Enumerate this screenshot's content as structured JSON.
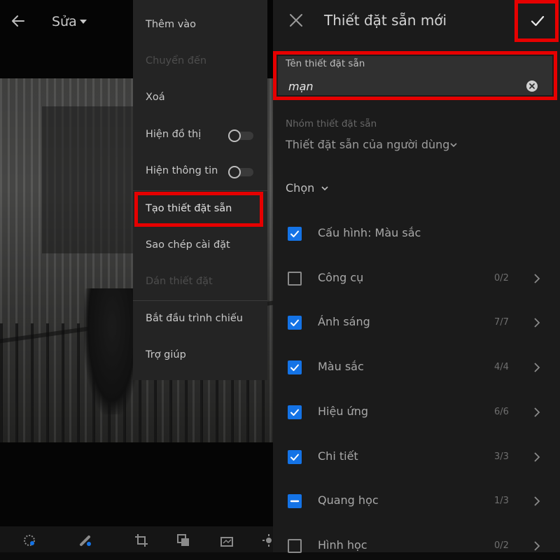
{
  "left": {
    "title": "Sửa"
  },
  "menu": {
    "items": [
      {
        "label": "Thêm vào",
        "disabled": false
      },
      {
        "label": "Chuyển đến",
        "disabled": true
      },
      {
        "label": "Xoá",
        "disabled": false
      },
      {
        "label": "Hiện đồ thị",
        "disabled": false,
        "toggle": false
      },
      {
        "label": "Hiện thông tin",
        "disabled": false,
        "toggle": false
      },
      {
        "label": "Tạo thiết đặt sẵn",
        "disabled": false,
        "highlighted": true
      },
      {
        "label": "Sao chép cài đặt",
        "disabled": false
      },
      {
        "label": "Dán thiết đặt",
        "disabled": true
      },
      {
        "label": "Bắt đầu trình chiếu",
        "disabled": false
      },
      {
        "label": "Trợ giúp",
        "disabled": false
      }
    ]
  },
  "panel": {
    "title": "Thiết đặt sẵn mới",
    "name_field": {
      "label": "Tên thiết đặt sẵn",
      "value": "mạn"
    },
    "group": {
      "label": "Nhóm thiết đặt sẵn",
      "value": "Thiết đặt sẵn của người dùng"
    },
    "choose_label": "Chọn",
    "options": [
      {
        "label": "Cấu hình: Màu sắc",
        "state": "checked",
        "count": ""
      },
      {
        "label": "Công cụ",
        "state": "unchecked",
        "count": "0/2"
      },
      {
        "label": "Ánh sáng",
        "state": "checked",
        "count": "7/7"
      },
      {
        "label": "Màu sắc",
        "state": "checked",
        "count": "4/4"
      },
      {
        "label": "Hiệu ứng",
        "state": "checked",
        "count": "6/6"
      },
      {
        "label": "Chi tiết",
        "state": "checked",
        "count": "3/3"
      },
      {
        "label": "Quang học",
        "state": "partial",
        "count": "1/3"
      },
      {
        "label": "Hình học",
        "state": "unchecked",
        "count": "0/2"
      }
    ]
  },
  "colors": {
    "accent": "#1473e6",
    "highlight": "#e60000"
  }
}
